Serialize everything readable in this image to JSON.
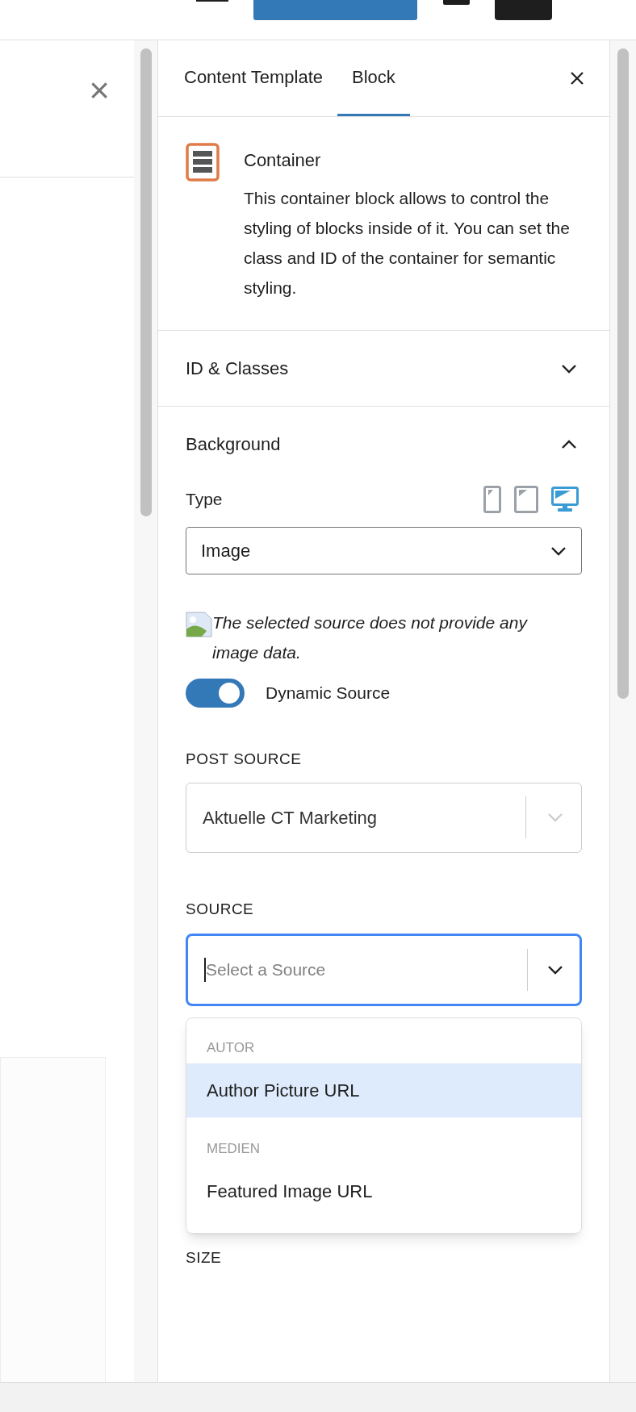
{
  "left_panel": {
    "close": "×"
  },
  "tabs": [
    {
      "label": "Content Template",
      "selected": false
    },
    {
      "label": "Block",
      "selected": true
    }
  ],
  "block": {
    "title": "Container",
    "description": "This container block allows to control the styling of blocks inside of it. You can set the class and ID of the container for semantic styling."
  },
  "sections": [
    {
      "title": "ID & Classes",
      "expanded": false
    },
    {
      "title": "Background",
      "expanded": true
    }
  ],
  "background": {
    "type_label": "Type",
    "devices": [
      {
        "kind": "mobile",
        "selected": false
      },
      {
        "kind": "tablet",
        "selected": false
      },
      {
        "kind": "desktop",
        "selected": true
      }
    ],
    "type_value": "Image",
    "notice": "The selected source does not provide any image data.",
    "dynamic_source": {
      "label": "Dynamic Source",
      "on": true
    },
    "post_source": {
      "label": "POST SOURCE",
      "value": "Aktuelle CT Marketing"
    },
    "source": {
      "label": "SOURCE",
      "placeholder": "Select a Source"
    },
    "menu": [
      {
        "group": "AUTOR",
        "options": [
          {
            "label": "Author Picture URL",
            "selected": true
          }
        ]
      },
      {
        "group": "MEDIEN",
        "options": [
          {
            "label": "Featured Image URL",
            "selected": false
          }
        ]
      }
    ],
    "size_label": "SIZE"
  }
}
